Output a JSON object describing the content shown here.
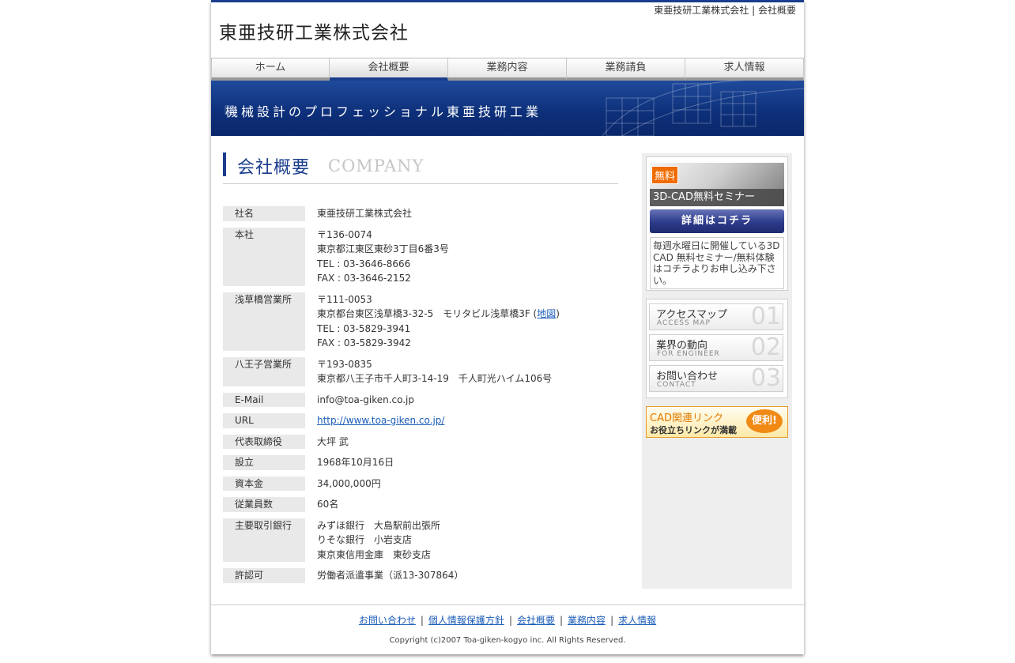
{
  "header": {
    "site_title": "東亜技研工業株式会社",
    "top_links": [
      "東亜技研工業株式会社",
      "会社概要"
    ],
    "top_sep": "|"
  },
  "nav": [
    {
      "label": "ホーム"
    },
    {
      "label": "会社概要",
      "active": true
    },
    {
      "label": "業務内容"
    },
    {
      "label": "業務請負"
    },
    {
      "label": "求人情報"
    }
  ],
  "banner": {
    "text": "機械設計のプロフェッショナル東亜技研工業"
  },
  "heading": {
    "jp": "会社概要",
    "en": "COMPANY"
  },
  "info": {
    "name": {
      "label": "社名",
      "value": "東亜技研工業株式会社"
    },
    "hq": {
      "label": "本社",
      "lines": [
        "〒136-0074",
        "東京都江東区東砂3丁目6番3号",
        "TEL : 03-3646-8666",
        "FAX : 03-3646-2152"
      ]
    },
    "asakusa": {
      "label": "浅草橋営業所",
      "zip": "〒111-0053",
      "addr": "東京都台東区浅草橋3-32-5　モリタビル浅草橋3F (",
      "map": "地図",
      "addr_end": ")",
      "tel": "TEL : 03-5829-3941",
      "fax": "FAX : 03-5829-3942"
    },
    "hachioji": {
      "label": "八王子営業所",
      "lines": [
        "〒193-0835",
        "東京都八王子市千人町3-14-19　千人町光ハイム106号"
      ]
    },
    "email": {
      "label": "E-Mail",
      "value": "info@toa-giken.co.jp"
    },
    "url": {
      "label": "URL",
      "value": "http://www.toa-giken.co.jp/"
    },
    "ceo": {
      "label": "代表取締役",
      "value": "大坪 武"
    },
    "founded": {
      "label": "設立",
      "value": "1968年10月16日"
    },
    "capital": {
      "label": "資本金",
      "value": "34,000,000円"
    },
    "employees": {
      "label": "従業員数",
      "value": "60名"
    },
    "banks": {
      "label": "主要取引銀行",
      "lines": [
        "みずほ銀行　大島駅前出張所",
        "りそな銀行　小岩支店",
        "東京東信用金庫　東砂支店"
      ]
    },
    "license": {
      "label": "許認可",
      "value": "労働者派遣事業（派13-307864）"
    }
  },
  "sidebar": {
    "seminar": {
      "badge": "無料",
      "title": "3D-CAD無料セミナー",
      "button": "詳細はコチラ",
      "note": "毎週水曜日に開催している3D CAD 無料セミナー/無料体験はコチラよりお申し込み下さい。"
    },
    "menu": [
      {
        "title": "アクセスマップ",
        "sub": "ACCESS MAP",
        "num": "01"
      },
      {
        "title": "業界の動向",
        "sub": "FOR ENGINEER",
        "num": "02"
      },
      {
        "title": "お問い合わせ",
        "sub": "CONTACT",
        "num": "03"
      }
    ],
    "cad": {
      "title": "CAD関連リンク",
      "sub": "お役立ちリンクが満載",
      "badge": "便利!"
    }
  },
  "footer": {
    "links": [
      "お問い合わせ",
      "個人情報保護方針",
      "会社概要",
      "業務内容",
      "求人情報"
    ],
    "sep": "|",
    "copyright": "Copyright (c)2007 Toa-giken-kogyo inc. All Rights Reserved."
  }
}
